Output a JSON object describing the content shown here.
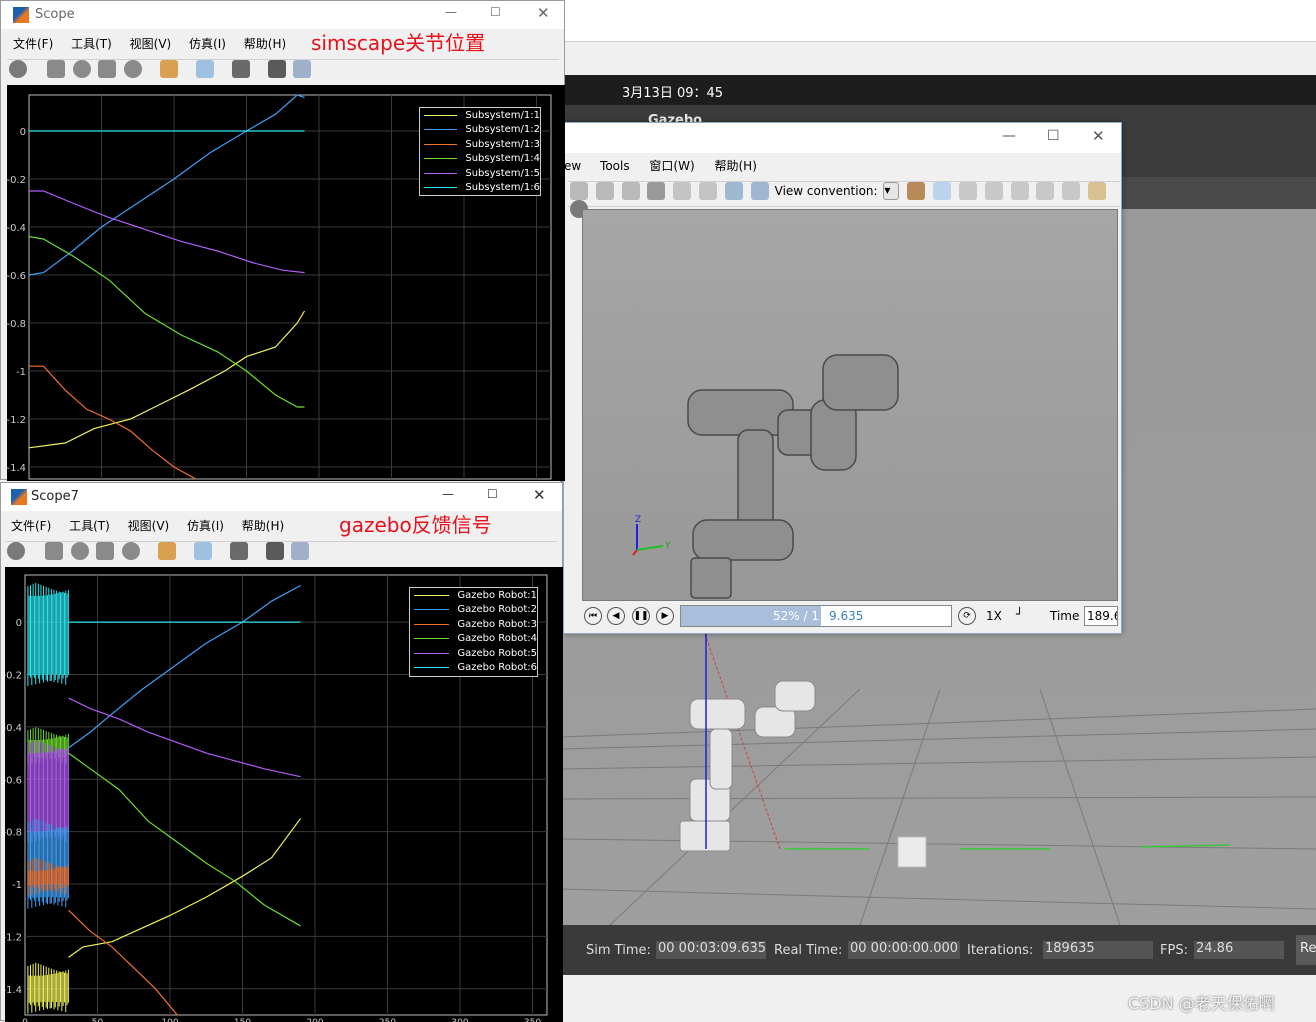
{
  "gazebo": {
    "clock": "3月13日  09：45",
    "title": "Gazebo",
    "sim_time_label": "Sim Time:",
    "sim_time": "00 00:03:09.635",
    "real_time_label": "Real Time:",
    "real_time": "00 00:00:00.000",
    "iterations_label": "Iterations:",
    "iterations": "189635",
    "fps_label": "FPS:",
    "fps": "24.86",
    "reset_label": "Re"
  },
  "mech": {
    "menu": [
      "ew",
      "Tools",
      "窗口(W)",
      "帮助(H)"
    ],
    "view_convention_label": "View convention:",
    "progress_text": "52% / 1",
    "progress_time": "9.635",
    "progress_fraction": 0.52,
    "speed": "1X",
    "time_label": "Time",
    "time_value": "189.6"
  },
  "scope1": {
    "title": "Scope",
    "menu": [
      "文件(F)",
      "工具(T)",
      "视图(V)",
      "仿真(I)",
      "帮助(H)"
    ],
    "annotation": "simscape关节位置",
    "annotation_color": "#e8101a",
    "yticks": [
      "0",
      "-0.2",
      "-0.4",
      "-0.6",
      "-0.8",
      "-1",
      "-1.2",
      "-1.4"
    ],
    "legend": [
      "Subsystem/1:1",
      "Subsystem/1:2",
      "Subsystem/1:3",
      "Subsystem/1:4",
      "Subsystem/1:5",
      "Subsystem/1:6"
    ]
  },
  "scope2": {
    "title": "Scope7",
    "menu": [
      "文件(F)",
      "工具(T)",
      "视图(V)",
      "仿真(I)",
      "帮助(H)"
    ],
    "annotation": "gazebo反馈信号",
    "annotation_color": "#e8101a",
    "yticks": [
      "0",
      "-0.2",
      "-0.4",
      "-0.6",
      "-0.8",
      "-1",
      "-1.2",
      "-1.4"
    ],
    "xticks": [
      "0",
      "50",
      "100",
      "150",
      "200",
      "250",
      "300",
      "350"
    ],
    "legend": [
      "Gazebo Robot:1",
      "Gazebo Robot:2",
      "Gazebo Robot:3",
      "Gazebo Robot:4",
      "Gazebo Robot:5",
      "Gazebo Robot:6"
    ]
  },
  "series_colors": [
    "#f2f25c",
    "#3ea0f5",
    "#f26f2c",
    "#6edc30",
    "#b25cf5",
    "#2ce8f2"
  ],
  "chart_data": [
    {
      "type": "line",
      "ylim": [
        -1.45,
        0.15
      ],
      "xlim": [
        0,
        360
      ],
      "grid": true,
      "legend_position": "top-right",
      "series": [
        {
          "name": "Subsystem/1:1",
          "x": [
            0,
            25,
            45,
            70,
            90,
            110,
            135,
            150,
            170,
            185,
            190
          ],
          "y": [
            -1.32,
            -1.3,
            -1.24,
            -1.2,
            -1.14,
            -1.08,
            -1.0,
            -0.94,
            -0.9,
            -0.8,
            -0.75
          ]
        },
        {
          "name": "Subsystem/1:2",
          "x": [
            0,
            10,
            30,
            50,
            75,
            100,
            125,
            150,
            170,
            185,
            190
          ],
          "y": [
            -0.6,
            -0.59,
            -0.5,
            -0.4,
            -0.3,
            -0.2,
            -0.09,
            0.0,
            0.07,
            0.15,
            0.14
          ]
        },
        {
          "name": "Subsystem/1:3",
          "x": [
            0,
            10,
            25,
            40,
            55,
            70,
            85,
            100,
            115
          ],
          "y": [
            -0.98,
            -0.98,
            -1.08,
            -1.16,
            -1.2,
            -1.25,
            -1.33,
            -1.4,
            -1.45
          ]
        },
        {
          "name": "Subsystem/1:4",
          "x": [
            0,
            10,
            30,
            55,
            80,
            105,
            130,
            150,
            170,
            185,
            190
          ],
          "y": [
            -0.44,
            -0.45,
            -0.52,
            -0.62,
            -0.76,
            -0.85,
            -0.92,
            -1.0,
            -1.1,
            -1.15,
            -1.15
          ]
        },
        {
          "name": "Subsystem/1:5",
          "x": [
            0,
            10,
            30,
            55,
            80,
            105,
            130,
            155,
            175,
            190
          ],
          "y": [
            -0.25,
            -0.25,
            -0.3,
            -0.36,
            -0.41,
            -0.46,
            -0.5,
            -0.55,
            -0.58,
            -0.59
          ]
        },
        {
          "name": "Subsystem/1:6",
          "x": [
            0,
            190
          ],
          "y": [
            0,
            0
          ]
        }
      ]
    },
    {
      "type": "line",
      "ylim": [
        -1.5,
        0.18
      ],
      "xlim": [
        0,
        360
      ],
      "grid": true,
      "legend_position": "top-right",
      "series": [
        {
          "name": "Gazebo Robot:1",
          "x": [
            30,
            40,
            60,
            80,
            100,
            125,
            150,
            170,
            190
          ],
          "y": [
            -1.28,
            -1.24,
            -1.22,
            -1.17,
            -1.12,
            -1.05,
            -0.97,
            -0.9,
            -0.75
          ]
        },
        {
          "name": "Gazebo Robot:2",
          "x": [
            30,
            45,
            60,
            80,
            100,
            125,
            150,
            170,
            190
          ],
          "y": [
            -0.48,
            -0.42,
            -0.35,
            -0.26,
            -0.18,
            -0.08,
            0.0,
            0.08,
            0.14
          ]
        },
        {
          "name": "Gazebo Robot:3",
          "x": [
            30,
            45,
            60,
            75,
            90,
            105
          ],
          "y": [
            -1.1,
            -1.18,
            -1.24,
            -1.32,
            -1.4,
            -1.5
          ]
        },
        {
          "name": "Gazebo Robot:4",
          "x": [
            30,
            45,
            65,
            85,
            105,
            125,
            145,
            165,
            190
          ],
          "y": [
            -0.5,
            -0.56,
            -0.64,
            -0.76,
            -0.84,
            -0.92,
            -0.99,
            -1.08,
            -1.16
          ]
        },
        {
          "name": "Gazebo Robot:5",
          "x": [
            30,
            45,
            65,
            85,
            105,
            125,
            145,
            165,
            190
          ],
          "y": [
            -0.29,
            -0.33,
            -0.37,
            -0.42,
            -0.46,
            -0.5,
            -0.53,
            -0.56,
            -0.59
          ]
        },
        {
          "name": "Gazebo Robot:6",
          "x": [
            30,
            190
          ],
          "y": [
            0,
            0
          ]
        }
      ]
    }
  ]
}
